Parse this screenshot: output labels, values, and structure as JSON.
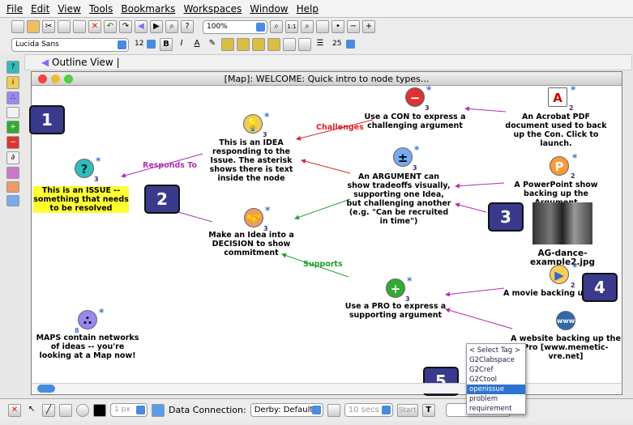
{
  "menu": [
    "File",
    "Edit",
    "View",
    "Tools",
    "Bookmarks",
    "Workspaces",
    "Window",
    "Help"
  ],
  "toolbar": {
    "zoom": "100%",
    "zoom_actual": "1:1"
  },
  "format": {
    "font": "Lucida Sans",
    "size": "12",
    "bold": "B",
    "italic": "I",
    "color": "A",
    "spacing": "25"
  },
  "outline": {
    "label": "Outline View |"
  },
  "window": {
    "title": "[Map]: WELCOME: Quick intro to node types..."
  },
  "nodes": {
    "issue": {
      "text": "This is an ISSUE -- something that needs to be resolved",
      "count": "3"
    },
    "idea": {
      "text": "This is an IDEA responding to the Issue. The asterisk shows there is text inside the node",
      "count": "3"
    },
    "con": {
      "text": "Use a CON to express a challenging argument",
      "count": "3"
    },
    "pdf": {
      "text": "An Acrobat PDF document used to back up the Con. Click to launch.",
      "count": "2"
    },
    "argument": {
      "text": "An ARGUMENT can show tradeoffs visually, supporting one Idea, but challenging another (e.g. \"Can be recruited in time\")",
      "count": "3"
    },
    "ppt": {
      "text": "A PowerPoint show backing up the Argument",
      "count": "2"
    },
    "image": {
      "text": "AG-dance-example2.jpg"
    },
    "decision": {
      "text": "Make an Idea into a DECISION to show commitment",
      "count": "3"
    },
    "pro": {
      "text": "Use a PRO to express a supporting argument",
      "count": "3"
    },
    "movie": {
      "text": "A movie backing up the Pro",
      "count": "2"
    },
    "website": {
      "text": "A website backing up the Pro [www.memetic-vre.net]"
    },
    "map": {
      "text": "MAPS contain networks of ideas -- you're looking at a Map now!",
      "count": "8"
    }
  },
  "links": {
    "challenges": "Challenges",
    "responds": "Responds To",
    "supports": "Supports"
  },
  "badges": [
    "1",
    "2",
    "3",
    "4",
    "5"
  ],
  "tags": {
    "options": [
      "< Select Tag >",
      "G2Clabspace",
      "G2Cref",
      "G2Ctool",
      "openissue",
      "problem",
      "requirement"
    ],
    "selected": "openissue"
  },
  "status": {
    "line": "1 px",
    "data_conn_label": "Data Connection:",
    "data_conn": "Derby: Default",
    "interval": "10 secs",
    "start": "Start",
    "tag_btn": "T"
  },
  "colors": {
    "challenges": "#e0202a",
    "responds": "#b030b0",
    "supports": "#20a030",
    "badge": "#3a3a8c",
    "highlight": "#ffff33"
  }
}
